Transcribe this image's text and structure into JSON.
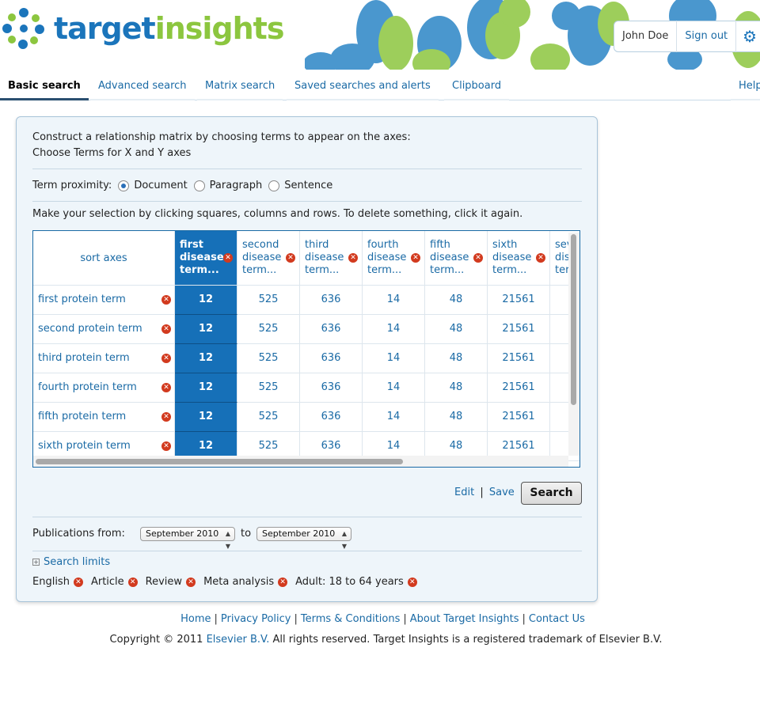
{
  "brand": {
    "name_part1": "target",
    "name_part2": "insights"
  },
  "user": {
    "name": "John Doe",
    "sign_out": "Sign out",
    "settings_icon": "gear-icon"
  },
  "tabs": [
    {
      "label": "Basic search",
      "active": true
    },
    {
      "label": "Advanced search"
    },
    {
      "label": "Matrix search"
    },
    {
      "label": "Saved searches and alerts"
    },
    {
      "label": "Clipboard"
    },
    {
      "label": "Help"
    }
  ],
  "panel": {
    "intro": "Construct a relationship matrix by choosing terms to appear on the axes:",
    "choose_link": "Choose Terms for X and Y axes",
    "proximity": {
      "label": "Term proximity:",
      "options": [
        "Document",
        "Paragraph",
        "Sentence"
      ],
      "selected": "Document"
    },
    "instructions": "Make your selection by clicking squares, columns and rows. To delete something, click it again."
  },
  "matrix": {
    "sort_label": "sort axes",
    "columns": [
      {
        "line1": "first",
        "line2": "disease",
        "line3": "term...",
        "selected": true
      },
      {
        "line1": "second",
        "line2": "disease",
        "line3": "term..."
      },
      {
        "line1": "third",
        "line2": "disease",
        "line3": "term..."
      },
      {
        "line1": "fourth",
        "line2": "disease",
        "line3": "term..."
      },
      {
        "line1": "fifth",
        "line2": "disease",
        "line3": "term..."
      },
      {
        "line1": "sixth",
        "line2": "disease",
        "line3": "term..."
      },
      {
        "line1": "seventh",
        "line2": "disease",
        "line3": "term..."
      }
    ],
    "rows": [
      {
        "label": "first protein term",
        "values": [
          "12",
          "525",
          "636",
          "14",
          "48",
          "21561"
        ]
      },
      {
        "label": "second protein term",
        "values": [
          "12",
          "525",
          "636",
          "14",
          "48",
          "21561"
        ]
      },
      {
        "label": "third protein term",
        "values": [
          "12",
          "525",
          "636",
          "14",
          "48",
          "21561"
        ]
      },
      {
        "label": "fourth protein term",
        "values": [
          "12",
          "525",
          "636",
          "14",
          "48",
          "21561"
        ]
      },
      {
        "label": "fifth protein term",
        "values": [
          "12",
          "525",
          "636",
          "14",
          "48",
          "21561"
        ]
      },
      {
        "label": "sixth protein term",
        "values": [
          "12",
          "525",
          "636",
          "14",
          "48",
          "21561"
        ]
      }
    ]
  },
  "actions": {
    "edit": "Edit",
    "sep": "|",
    "save": "Save",
    "search": "Search"
  },
  "publications": {
    "label": "Publications from:",
    "from": "September 2010",
    "to_label": "to",
    "to": "September 2010"
  },
  "search_limits": {
    "label": "Search limits",
    "items": [
      "English",
      "Article",
      "Review",
      "Meta analysis",
      "Adult: 18 to 64 years"
    ]
  },
  "footer": {
    "links": [
      "Home",
      "Privacy Policy",
      "Terms & Conditions",
      "About Target Insights",
      "Contact Us"
    ],
    "copyright_pre": "Copyright © 2011",
    "copyright_link": "Elsevier B.V.",
    "copyright_post": "All rights reserved. Target Insights is a registered trademark of Elsevier B.V."
  }
}
